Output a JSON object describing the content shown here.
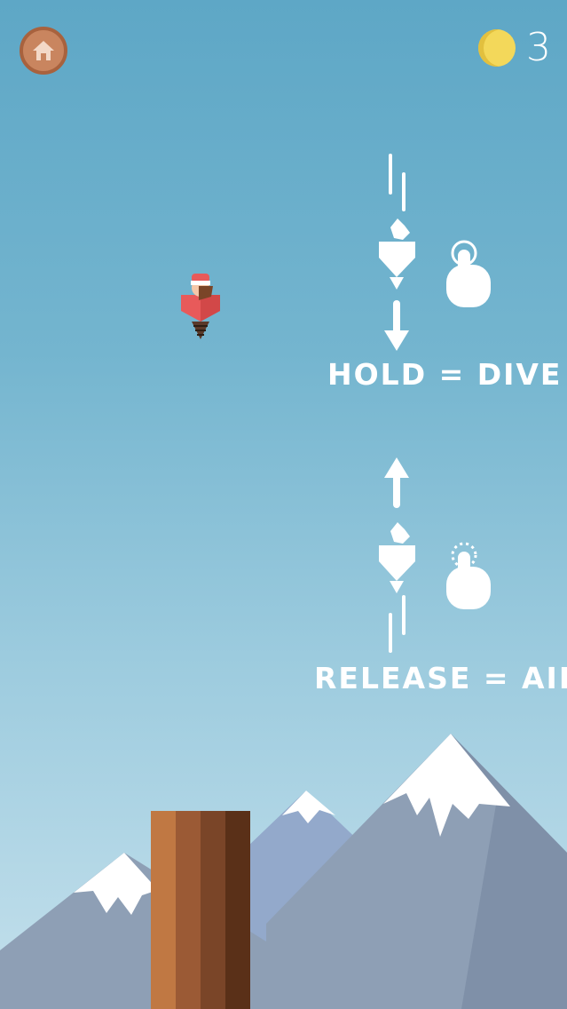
{
  "hud": {
    "home_icon": "home-icon",
    "coin_icon": "coin-icon",
    "coin_count": "3"
  },
  "tutorial": {
    "hold_text": "HOLD =  DIVE",
    "release_text": "RELEASE =  AIR"
  },
  "colors": {
    "sky_top": "#5ea7c6",
    "sky_bottom": "#c4e0ec",
    "home_button": "#c9855f",
    "coin": "#f3d85a",
    "player_body": "#e85a5a",
    "mountain": "#8e9fb5",
    "snow": "#ffffff",
    "pillar": "#9b5a35"
  }
}
